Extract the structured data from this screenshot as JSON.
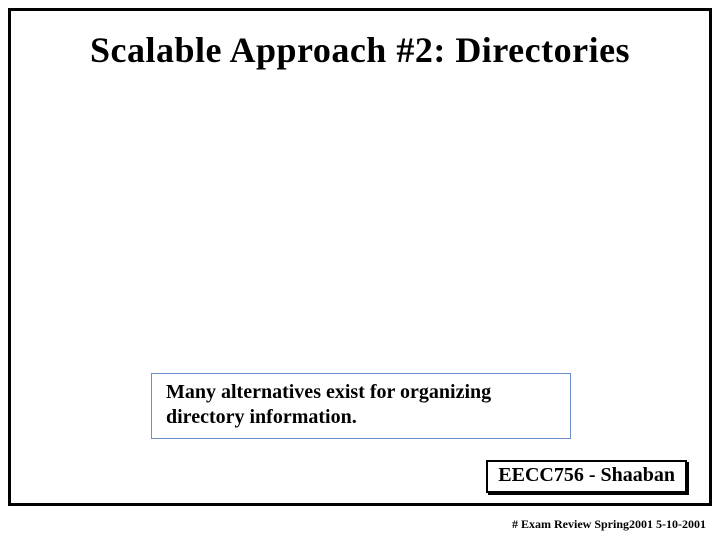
{
  "slide": {
    "title": "Scalable Approach #2: Directories",
    "note": "Many alternatives exist for organizing directory information.",
    "course_label": "EECC756 - Shaaban",
    "footer": "#   Exam Review   Spring2001  5-10-2001"
  }
}
